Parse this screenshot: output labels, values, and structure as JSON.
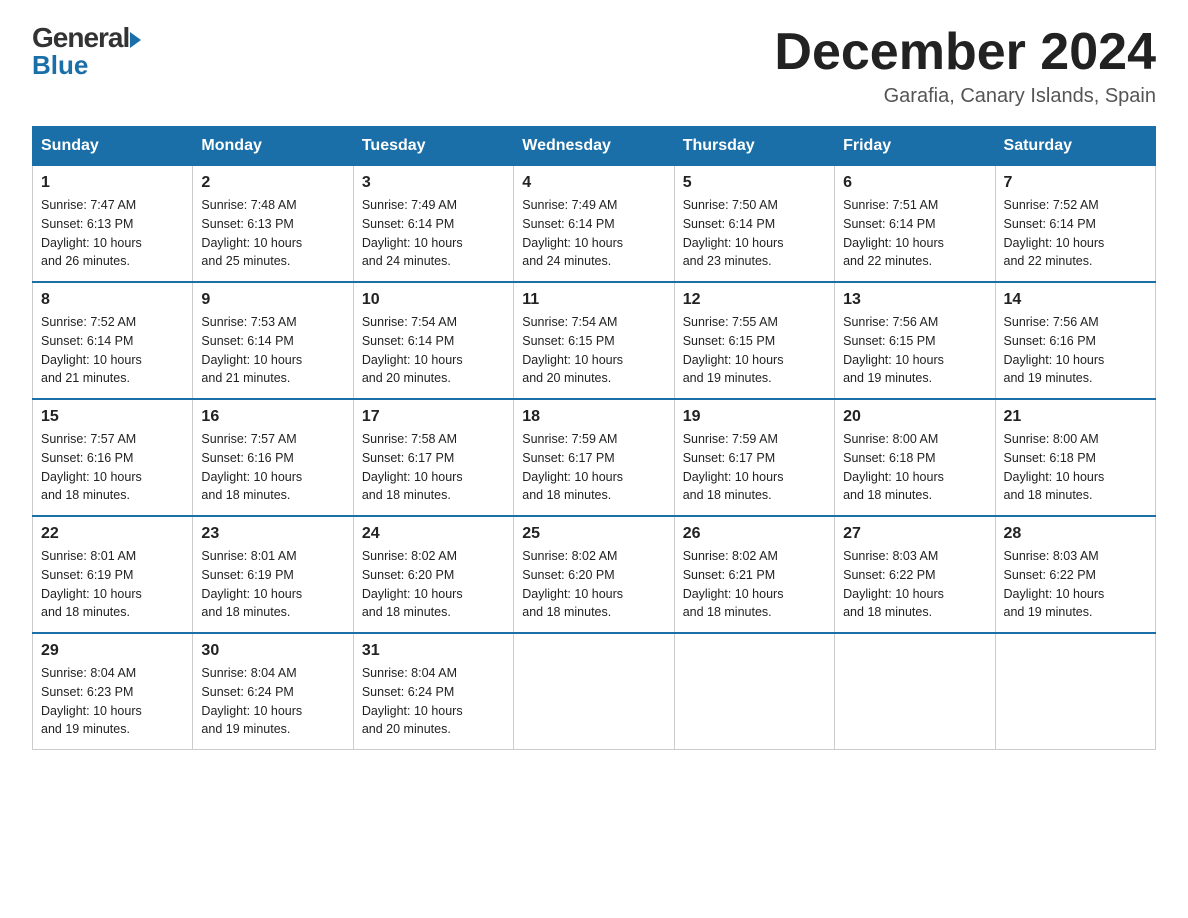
{
  "header": {
    "logo_line1": "General",
    "logo_line2": "Blue",
    "month_title": "December 2024",
    "location": "Garafia, Canary Islands, Spain"
  },
  "weekdays": [
    "Sunday",
    "Monday",
    "Tuesday",
    "Wednesday",
    "Thursday",
    "Friday",
    "Saturday"
  ],
  "weeks": [
    [
      {
        "day": "1",
        "sunrise": "7:47 AM",
        "sunset": "6:13 PM",
        "daylight": "10 hours and 26 minutes."
      },
      {
        "day": "2",
        "sunrise": "7:48 AM",
        "sunset": "6:13 PM",
        "daylight": "10 hours and 25 minutes."
      },
      {
        "day": "3",
        "sunrise": "7:49 AM",
        "sunset": "6:14 PM",
        "daylight": "10 hours and 24 minutes."
      },
      {
        "day": "4",
        "sunrise": "7:49 AM",
        "sunset": "6:14 PM",
        "daylight": "10 hours and 24 minutes."
      },
      {
        "day": "5",
        "sunrise": "7:50 AM",
        "sunset": "6:14 PM",
        "daylight": "10 hours and 23 minutes."
      },
      {
        "day": "6",
        "sunrise": "7:51 AM",
        "sunset": "6:14 PM",
        "daylight": "10 hours and 22 minutes."
      },
      {
        "day": "7",
        "sunrise": "7:52 AM",
        "sunset": "6:14 PM",
        "daylight": "10 hours and 22 minutes."
      }
    ],
    [
      {
        "day": "8",
        "sunrise": "7:52 AM",
        "sunset": "6:14 PM",
        "daylight": "10 hours and 21 minutes."
      },
      {
        "day": "9",
        "sunrise": "7:53 AM",
        "sunset": "6:14 PM",
        "daylight": "10 hours and 21 minutes."
      },
      {
        "day": "10",
        "sunrise": "7:54 AM",
        "sunset": "6:14 PM",
        "daylight": "10 hours and 20 minutes."
      },
      {
        "day": "11",
        "sunrise": "7:54 AM",
        "sunset": "6:15 PM",
        "daylight": "10 hours and 20 minutes."
      },
      {
        "day": "12",
        "sunrise": "7:55 AM",
        "sunset": "6:15 PM",
        "daylight": "10 hours and 19 minutes."
      },
      {
        "day": "13",
        "sunrise": "7:56 AM",
        "sunset": "6:15 PM",
        "daylight": "10 hours and 19 minutes."
      },
      {
        "day": "14",
        "sunrise": "7:56 AM",
        "sunset": "6:16 PM",
        "daylight": "10 hours and 19 minutes."
      }
    ],
    [
      {
        "day": "15",
        "sunrise": "7:57 AM",
        "sunset": "6:16 PM",
        "daylight": "10 hours and 18 minutes."
      },
      {
        "day": "16",
        "sunrise": "7:57 AM",
        "sunset": "6:16 PM",
        "daylight": "10 hours and 18 minutes."
      },
      {
        "day": "17",
        "sunrise": "7:58 AM",
        "sunset": "6:17 PM",
        "daylight": "10 hours and 18 minutes."
      },
      {
        "day": "18",
        "sunrise": "7:59 AM",
        "sunset": "6:17 PM",
        "daylight": "10 hours and 18 minutes."
      },
      {
        "day": "19",
        "sunrise": "7:59 AM",
        "sunset": "6:17 PM",
        "daylight": "10 hours and 18 minutes."
      },
      {
        "day": "20",
        "sunrise": "8:00 AM",
        "sunset": "6:18 PM",
        "daylight": "10 hours and 18 minutes."
      },
      {
        "day": "21",
        "sunrise": "8:00 AM",
        "sunset": "6:18 PM",
        "daylight": "10 hours and 18 minutes."
      }
    ],
    [
      {
        "day": "22",
        "sunrise": "8:01 AM",
        "sunset": "6:19 PM",
        "daylight": "10 hours and 18 minutes."
      },
      {
        "day": "23",
        "sunrise": "8:01 AM",
        "sunset": "6:19 PM",
        "daylight": "10 hours and 18 minutes."
      },
      {
        "day": "24",
        "sunrise": "8:02 AM",
        "sunset": "6:20 PM",
        "daylight": "10 hours and 18 minutes."
      },
      {
        "day": "25",
        "sunrise": "8:02 AM",
        "sunset": "6:20 PM",
        "daylight": "10 hours and 18 minutes."
      },
      {
        "day": "26",
        "sunrise": "8:02 AM",
        "sunset": "6:21 PM",
        "daylight": "10 hours and 18 minutes."
      },
      {
        "day": "27",
        "sunrise": "8:03 AM",
        "sunset": "6:22 PM",
        "daylight": "10 hours and 18 minutes."
      },
      {
        "day": "28",
        "sunrise": "8:03 AM",
        "sunset": "6:22 PM",
        "daylight": "10 hours and 19 minutes."
      }
    ],
    [
      {
        "day": "29",
        "sunrise": "8:04 AM",
        "sunset": "6:23 PM",
        "daylight": "10 hours and 19 minutes."
      },
      {
        "day": "30",
        "sunrise": "8:04 AM",
        "sunset": "6:24 PM",
        "daylight": "10 hours and 19 minutes."
      },
      {
        "day": "31",
        "sunrise": "8:04 AM",
        "sunset": "6:24 PM",
        "daylight": "10 hours and 20 minutes."
      },
      null,
      null,
      null,
      null
    ]
  ],
  "labels": {
    "sunrise": "Sunrise:",
    "sunset": "Sunset:",
    "daylight": "Daylight:"
  }
}
